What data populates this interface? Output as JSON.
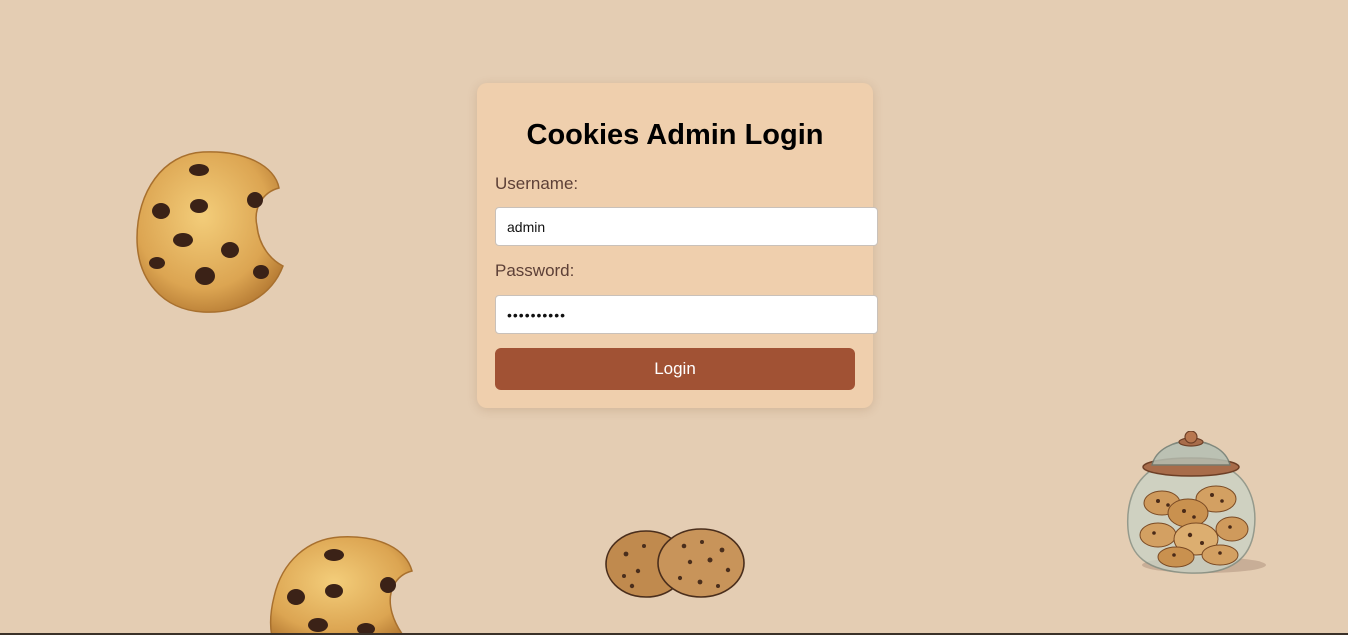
{
  "login": {
    "title": "Cookies Admin Login",
    "username_label": "Username:",
    "username_value": "admin",
    "password_label": "Password:",
    "password_value": "••••••••••",
    "button_label": "Login"
  },
  "colors": {
    "background": "#e4cdb3",
    "card": "#efcfad",
    "button": "#a15234",
    "label": "#5d4037"
  },
  "decorations": [
    "cookie-bitten-icon",
    "cookie-bitten-icon",
    "cookie-pair-icon",
    "cookie-jar-icon"
  ]
}
